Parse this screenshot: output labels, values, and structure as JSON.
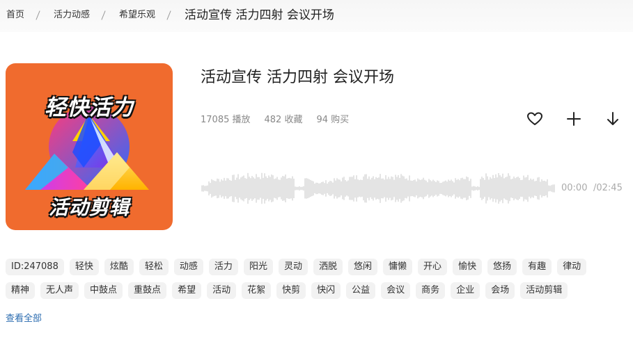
{
  "breadcrumb": {
    "home": "首页",
    "level1": "活力动感",
    "level2": "希望乐观",
    "current": "活动宣传 活力四射 会议开场"
  },
  "cover": {
    "top_text": "轻快活力",
    "bottom_text": "活动剪辑",
    "background_color": "#f06b2e"
  },
  "track": {
    "title": "活动宣传 活力四射 会议开场",
    "plays": "17085 播放",
    "favorites": "482 收藏",
    "purchases": "94 购买"
  },
  "actions": {
    "favorite_icon": "heart-icon",
    "add_icon": "plus-icon",
    "download_icon": "download-arrow-icon"
  },
  "player": {
    "current_time": "00:00",
    "duration": "/02:45",
    "progress": 0
  },
  "tags": [
    "ID:247088",
    "轻快",
    "炫酷",
    "轻松",
    "动感",
    "活力",
    "阳光",
    "灵动",
    "洒脱",
    "悠闲",
    "慵懒",
    "开心",
    "愉快",
    "悠扬",
    "有趣",
    "律动",
    "精神",
    "无人声",
    "中鼓点",
    "重鼓点",
    "希望",
    "活动",
    "花絮",
    "快剪",
    "快闪",
    "公益",
    "会议",
    "商务",
    "企业",
    "会场",
    "活动剪辑"
  ],
  "view_all": "查看全部"
}
